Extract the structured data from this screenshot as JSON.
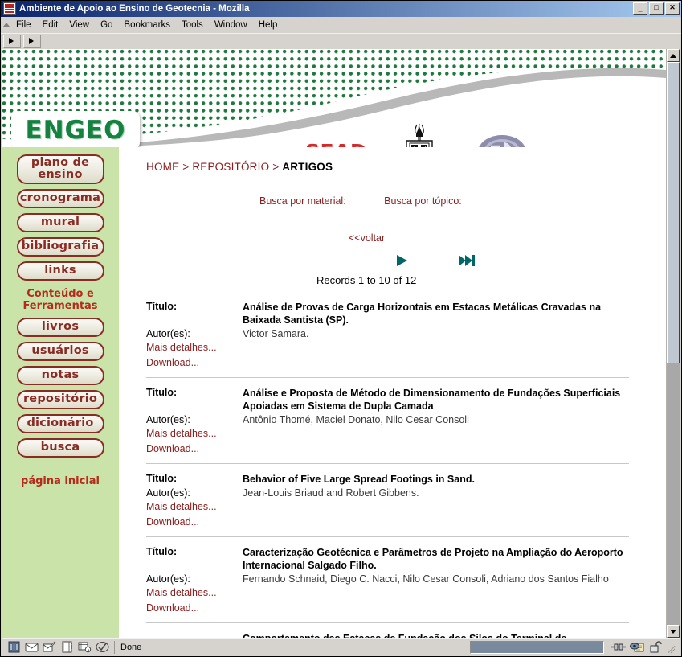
{
  "window": {
    "title": "Ambiente de Apoio ao Ensino de Geotecnia - Mozilla",
    "icon": "mozilla-icon",
    "controls": {
      "minimize": "_",
      "maximize": "□",
      "close": "✕"
    }
  },
  "menu": {
    "items": [
      {
        "label": "File"
      },
      {
        "label": "Edit"
      },
      {
        "label": "View"
      },
      {
        "label": "Go"
      },
      {
        "label": "Bookmarks"
      },
      {
        "label": "Tools"
      },
      {
        "label": "Window"
      },
      {
        "label": "Help"
      }
    ]
  },
  "banner": {
    "logo_text": "ENGEO",
    "sead_text": "SEAD",
    "shield_label": "university-shield-logo",
    "ead_label": "ead-oval-logo"
  },
  "sidebar": {
    "items": [
      {
        "label": "plano de\nensino",
        "name": "plano-de-ensino",
        "two_line": true
      },
      {
        "label": "cronograma",
        "name": "cronograma",
        "two_line": false
      },
      {
        "label": "mural",
        "name": "mural",
        "two_line": false
      },
      {
        "label": "bibliografia",
        "name": "bibliografia",
        "two_line": false
      },
      {
        "label": "links",
        "name": "links",
        "two_line": false
      }
    ],
    "section_heading": "Conteúdo e\nFerramentas",
    "tools": [
      {
        "label": "livros",
        "name": "livros"
      },
      {
        "label": "usuários",
        "name": "usuarios"
      },
      {
        "label": "notas",
        "name": "notas"
      },
      {
        "label": "repositório",
        "name": "repositorio"
      },
      {
        "label": "dicionário",
        "name": "dicionario"
      },
      {
        "label": "busca",
        "name": "busca"
      }
    ],
    "home_link": "página inicial"
  },
  "content": {
    "breadcrumb": {
      "home": "HOME",
      "sep1": " > ",
      "level2": "REPOSITÓRIO",
      "sep2": " > ",
      "current": "ARTIGOS"
    },
    "search_material_label": "Busca por material:",
    "search_topic_label": "Busca por tópico:",
    "back_link": "<<voltar",
    "nav_next_icon": "play-next-icon",
    "nav_last_icon": "skip-to-last-icon",
    "records_summary": "Records 1 to 10 of 12",
    "labels": {
      "title": "Título:",
      "authors": "Autor(es):",
      "details": "Mais detalhes...",
      "download": "Download..."
    },
    "records": [
      {
        "title": "Análise de Provas de Carga Horizontais em Estacas Metálicas Cravadas na Baixada Santista (SP).",
        "authors": "Victor Samara."
      },
      {
        "title": "Análise e Proposta de Método de Dimensionamento de Fundações Superficiais Apoiadas em Sistema de Dupla Camada",
        "authors": "Antônio Thomé, Maciel Donato, Nilo Cesar Consoli"
      },
      {
        "title": "Behavior of Five Large Spread Footings in Sand.",
        "authors": "Jean-Louis Briaud and Robert Gibbens."
      },
      {
        "title": "Caracterização Geotécnica e Parâmetros de Projeto na Ampliação do Aeroporto Internacional Salgado Filho.",
        "authors": "Fernando Schnaid, Diego C. Nacci, Nilo Cesar Consoli, Adriano dos Santos Fialho"
      },
      {
        "title": "Comportamento das Estacas de Fundação dos Silos do Terminal de",
        "authors": ""
      }
    ]
  },
  "statusbar": {
    "text": "Done",
    "icons": [
      "browser-icon",
      "mail-icon",
      "composer-icon",
      "addressbook-icon",
      "calendar-icon",
      "tasks-icon"
    ],
    "right_icons": [
      "connection-icon",
      "cookie-icon",
      "unlocked-padlock-icon"
    ]
  },
  "colors": {
    "titlebar": "#0a246a",
    "sidebar_green": "#c9e3a8",
    "link_red": "#8a1c1c",
    "heading_red": "#b52a1d",
    "banner_green": "#1d7a3c",
    "nav_teal": "#006666",
    "sead_red": "#d42a2a"
  }
}
